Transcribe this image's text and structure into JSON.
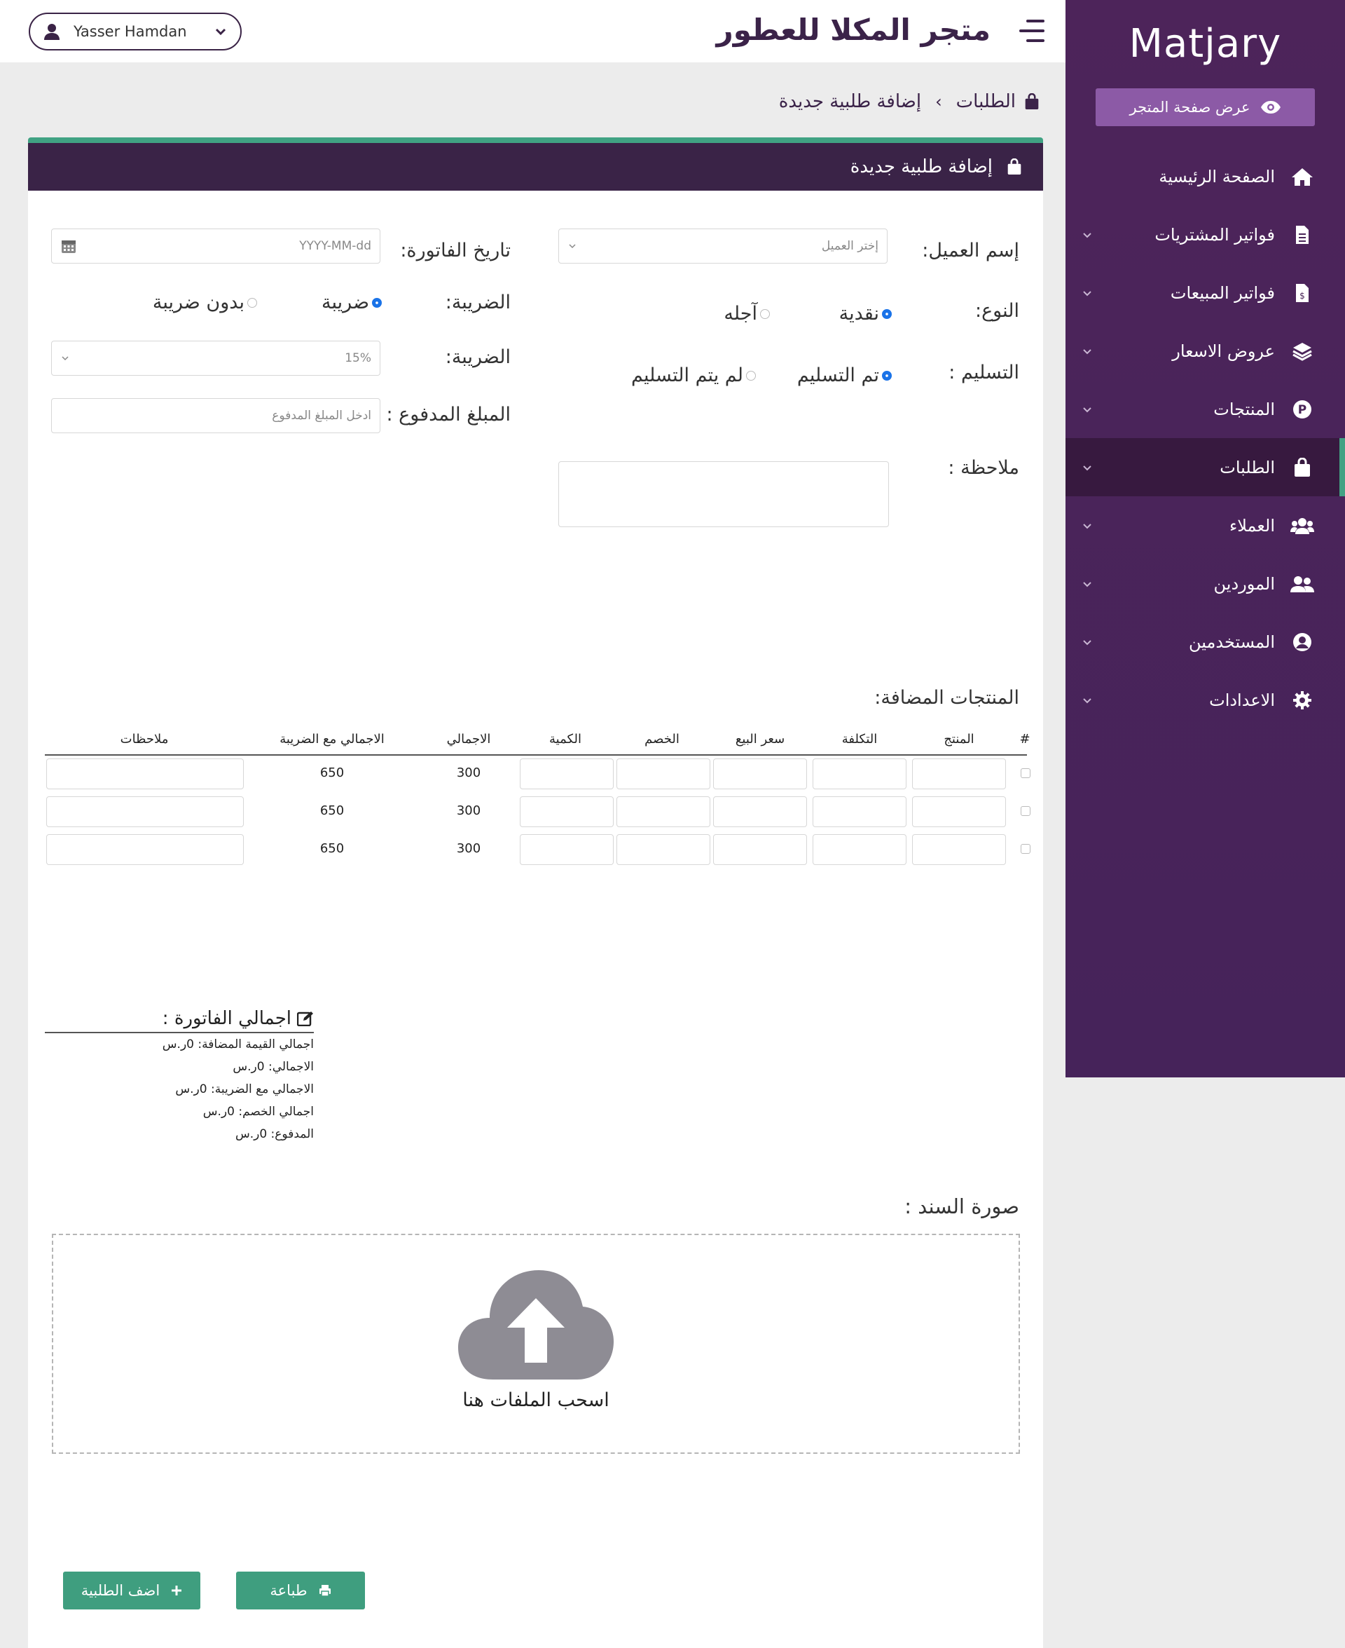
{
  "sidebar": {
    "brand": "Matjary",
    "store_button": "عرض صفحة المتجر",
    "items": [
      {
        "label": "الصفحة الرئيسية",
        "icon": "home-icon"
      },
      {
        "label": "فواتير المشتريات",
        "icon": "invoice-icon"
      },
      {
        "label": "فواتير المبيعات",
        "icon": "sales-invoice-icon"
      },
      {
        "label": "عروض الاسعار",
        "icon": "layers-icon"
      },
      {
        "label": "المنتجات",
        "icon": "product-p-icon"
      },
      {
        "label": "الطلبات",
        "icon": "shopping-bag-icon",
        "active": true
      },
      {
        "label": "العملاء",
        "icon": "users-group-icon"
      },
      {
        "label": "الموردين",
        "icon": "user-friends-icon"
      },
      {
        "label": "المستخدمين",
        "icon": "user-circle-icon"
      },
      {
        "label": "الاعدادات",
        "icon": "gear-icon"
      }
    ]
  },
  "header": {
    "store_title": "متجر المكلا للعطور",
    "user_name": "Yasser Hamdan"
  },
  "breadcrumb": {
    "parent": "الطلبات",
    "current": "إضافة طلبية جديدة"
  },
  "card": {
    "title": "إضافة طلبية جديدة"
  },
  "form": {
    "customer_label": "إسم العميل:",
    "customer_placeholder": "إختر العميل",
    "invoice_date_label": "تاريخ الفاتورة:",
    "invoice_date_placeholder": "YYYY-MM-dd",
    "type_label": "النوع:",
    "type_cash": "نقدية",
    "type_deferred": "آجله",
    "tax_label": "الضريبة:",
    "tax_with": "ضريبة",
    "tax_without": "بدون ضريبة",
    "delivery_label": "التسليم :",
    "delivery_done": "تم التسليم",
    "delivery_not": "لم يتم التسليم",
    "tax_rate_label": "الضريبة:",
    "tax_rate_value": "15%",
    "paid_label": "المبلغ المدفوع :",
    "paid_placeholder": "ادخل المبلغ المدفوع",
    "note_label": "ملاحظة :"
  },
  "products": {
    "title": "المنتجات المضافة:",
    "columns": [
      "#",
      "المنتج",
      "التكلفة",
      "سعر البيع",
      "الخصم",
      "الكمية",
      "الاجمالي",
      "الاجمالي مع الضريبة",
      "ملاحظات"
    ],
    "rows": [
      {
        "total": "300",
        "total_with_tax": "650"
      },
      {
        "total": "300",
        "total_with_tax": "650"
      },
      {
        "total": "300",
        "total_with_tax": "650"
      }
    ]
  },
  "totals": {
    "title": "اجمالي الفاتورة :",
    "rows": [
      "اجمالي القيمة المضافة: 0ر.س",
      "الاجمالي: 0ر.س",
      "الاجمالي مع الضريبة: 0ر.س",
      "اجمالي الخصم: 0ر.س",
      "المدفوع: 0ر.س"
    ]
  },
  "upload": {
    "label": "صورة السند :",
    "drop_text": "اسحب الملفات هنا"
  },
  "actions": {
    "print": "طباعة",
    "add_order": "اضف الطلبية"
  },
  "colors": {
    "sidebar_bg": "#4a2558",
    "header_dark": "#3a2347",
    "accent_green": "#40a283",
    "store_button": "#8c5aa6"
  }
}
